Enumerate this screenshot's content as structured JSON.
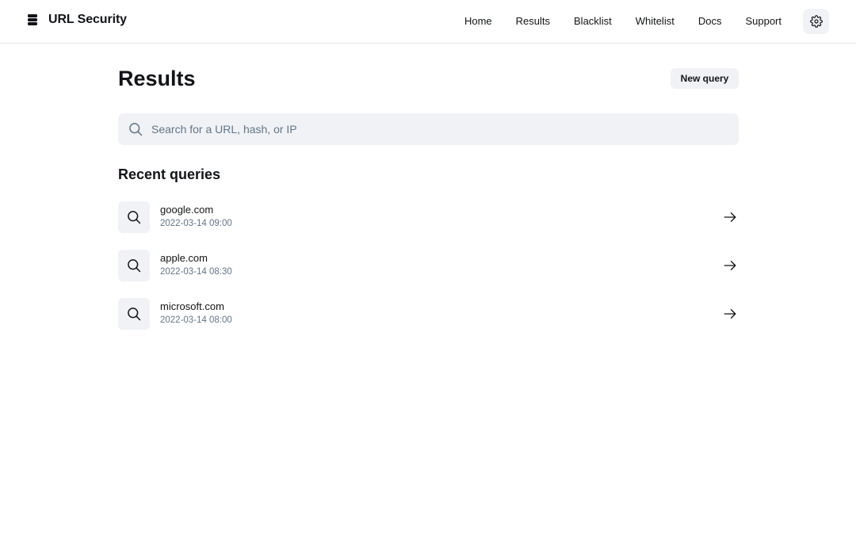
{
  "header": {
    "brand_name": "URL Security",
    "brand_icon": "stack-logo-icon",
    "nav": [
      {
        "label": "Home"
      },
      {
        "label": "Results"
      },
      {
        "label": "Blacklist"
      },
      {
        "label": "Whitelist"
      },
      {
        "label": "Docs"
      },
      {
        "label": "Support"
      }
    ],
    "settings_icon": "gear-icon"
  },
  "main": {
    "title": "Results",
    "new_query_label": "New query",
    "search": {
      "placeholder": "Search for a URL, hash, or IP",
      "value": "",
      "icon": "search-icon"
    },
    "recent_title": "Recent queries",
    "queries": [
      {
        "name": "google.com",
        "time": "2022-03-14 09:00"
      },
      {
        "name": "apple.com",
        "time": "2022-03-14 08:30"
      },
      {
        "name": "microsoft.com",
        "time": "2022-03-14 08:00"
      }
    ]
  },
  "colors": {
    "text_primary": "#121417",
    "text_secondary": "#637587",
    "surface": "#f0f2f5",
    "border": "#e5e8eb"
  }
}
